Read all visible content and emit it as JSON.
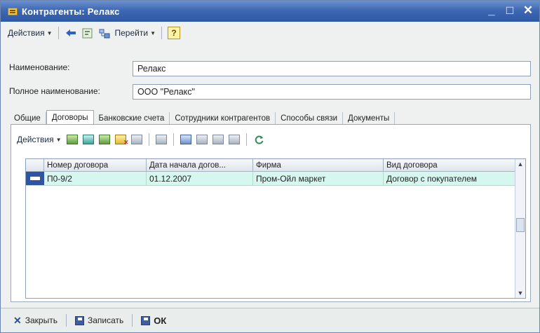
{
  "window": {
    "title": "Контрагенты: Релакс",
    "controls": {
      "minimize": "_",
      "maximize": "□",
      "close": "✕"
    }
  },
  "toolbar": {
    "actions_label": "Действия",
    "goto_label": "Перейти",
    "help_label": "?"
  },
  "form": {
    "name_label": "Наименование:",
    "name_value": "Релакс",
    "full_name_label": "Полное наименование:",
    "full_name_value": "ООО \"Релакс\""
  },
  "tabs": [
    {
      "label": "Общие"
    },
    {
      "label": "Договоры"
    },
    {
      "label": "Банковские счета"
    },
    {
      "label": "Сотрудники контрагентов"
    },
    {
      "label": "Способы связи"
    },
    {
      "label": "Документы"
    }
  ],
  "active_tab": "Договоры",
  "contracts_panel": {
    "actions_label": "Действия",
    "columns": [
      "Номер договора",
      "Дата начала догов...",
      "Фирма",
      "Вид договора"
    ],
    "rows": [
      {
        "number": "П0-9/2",
        "start_date": "01.12.2007",
        "firm": "Пром-Ойл маркет",
        "type": "Договор с покупателем"
      }
    ]
  },
  "footer": {
    "close_label": "Закрыть",
    "save_label": "Записать",
    "ok_label": "ОК"
  }
}
